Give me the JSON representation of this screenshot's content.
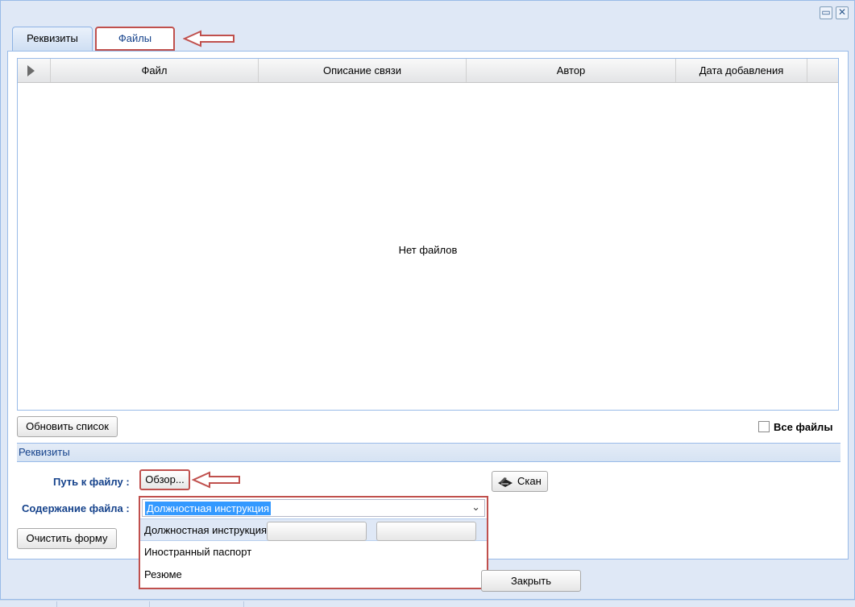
{
  "window": {
    "restore_icon": "restore-icon",
    "close_icon": "close-icon"
  },
  "tabs": [
    {
      "label": "Реквизиты",
      "active": false
    },
    {
      "label": "Файлы",
      "active": true
    }
  ],
  "grid": {
    "columns": [
      "Файл",
      "Описание связи",
      "Автор",
      "Дата добавления"
    ],
    "empty_text": "Нет файлов"
  },
  "toolbar": {
    "refresh_label": "Обновить список",
    "all_files_label": "Все файлы",
    "all_files_checked": false
  },
  "section": {
    "title": "Реквизиты"
  },
  "form": {
    "path_label": "Путь к файлу :",
    "browse_label": "Обзор...",
    "scan_label": "Скан",
    "content_label": "Содержание файла :",
    "content_value": "Должностная инструкция",
    "content_options": [
      "Должностная инструкция",
      "Иностранный паспорт",
      "Резюме"
    ],
    "clear_label": "Очистить форму"
  },
  "footer": {
    "close_label": "Закрыть"
  },
  "colors": {
    "highlight": "#c0504d",
    "accent": "#15428b",
    "window_bg": "#dfe8f6"
  }
}
